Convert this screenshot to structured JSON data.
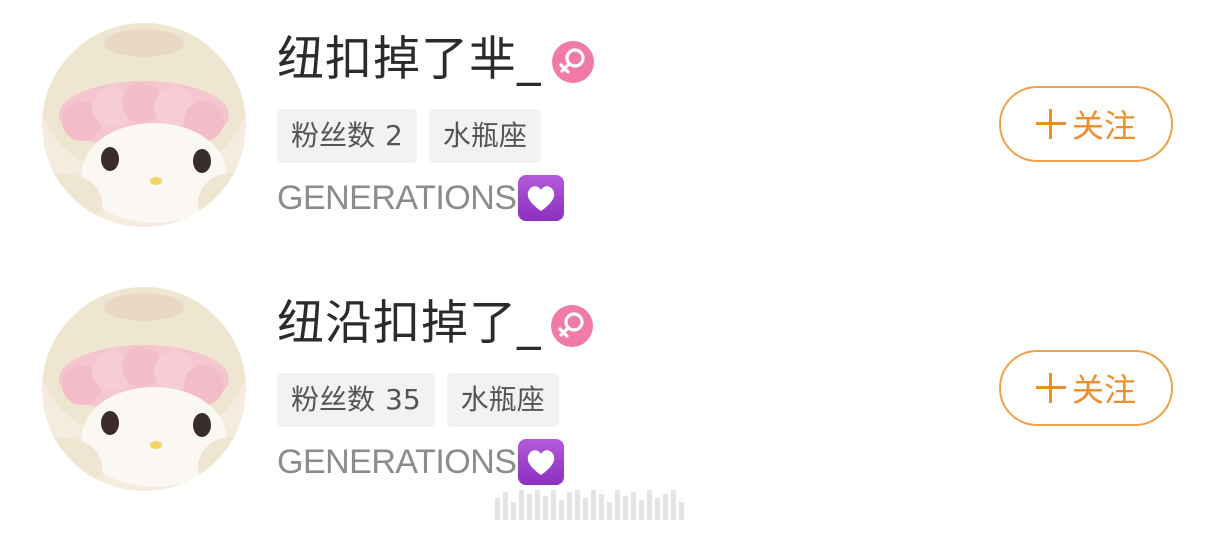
{
  "users": [
    {
      "name": "纽扣掉了芈_",
      "gender_icon": "female-icon",
      "gender_color": "#f07ba9",
      "fans_label": "粉丝数",
      "fans_count": "2",
      "zodiac": "水瓶座",
      "bio": "GENERATIONS",
      "bio_emoji": "purple-heart-icon",
      "follow_label": "关注"
    },
    {
      "name": "纽沿扣掉了_",
      "gender_icon": "female-icon",
      "gender_color": "#f07ba9",
      "fans_label": "粉丝数",
      "fans_count": "35",
      "zodiac": "水瓶座",
      "bio": "GENERATIONS",
      "bio_emoji": "purple-heart-icon",
      "follow_label": "关注"
    }
  ],
  "colors": {
    "accent": "#ef8d2c",
    "name_text": "#2b2b2b",
    "bio_text": "#8c8c8c",
    "tag_bg": "#f2f2f2"
  }
}
